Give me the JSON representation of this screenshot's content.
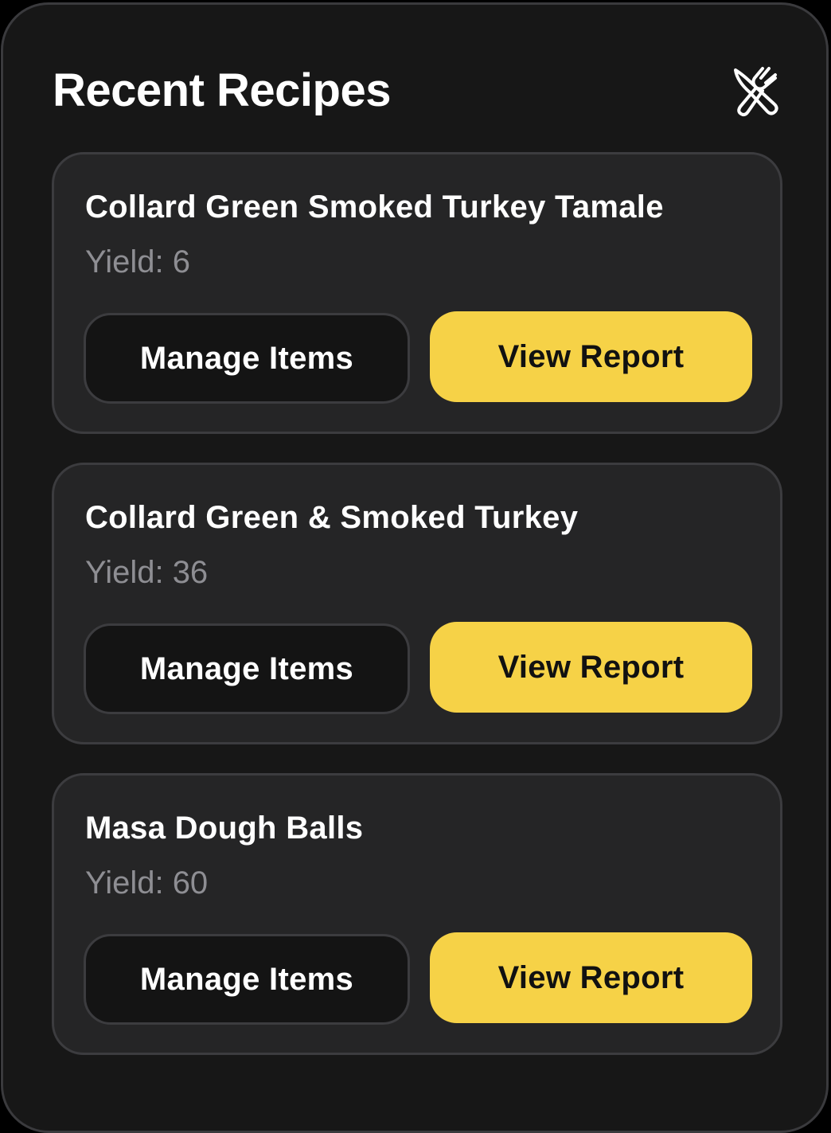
{
  "header": {
    "title": "Recent Recipes",
    "icon": "utensils-crossed-icon"
  },
  "recipes": [
    {
      "name": "Collard Green Smoked Turkey Tamale",
      "yield": "Yield: 6",
      "manage_label": "Manage Items",
      "report_label": "View Report"
    },
    {
      "name": "Collard Green & Smoked Turkey",
      "yield": "Yield: 36",
      "manage_label": "Manage Items",
      "report_label": "View Report"
    },
    {
      "name": "Masa Dough Balls",
      "yield": "Yield: 60",
      "manage_label": "Manage Items",
      "report_label": "View Report"
    }
  ],
  "colors": {
    "background": "#000000",
    "panel": "#171717",
    "card": "#252526",
    "accent": "#f6d247",
    "muted_text": "#8e8e93"
  }
}
